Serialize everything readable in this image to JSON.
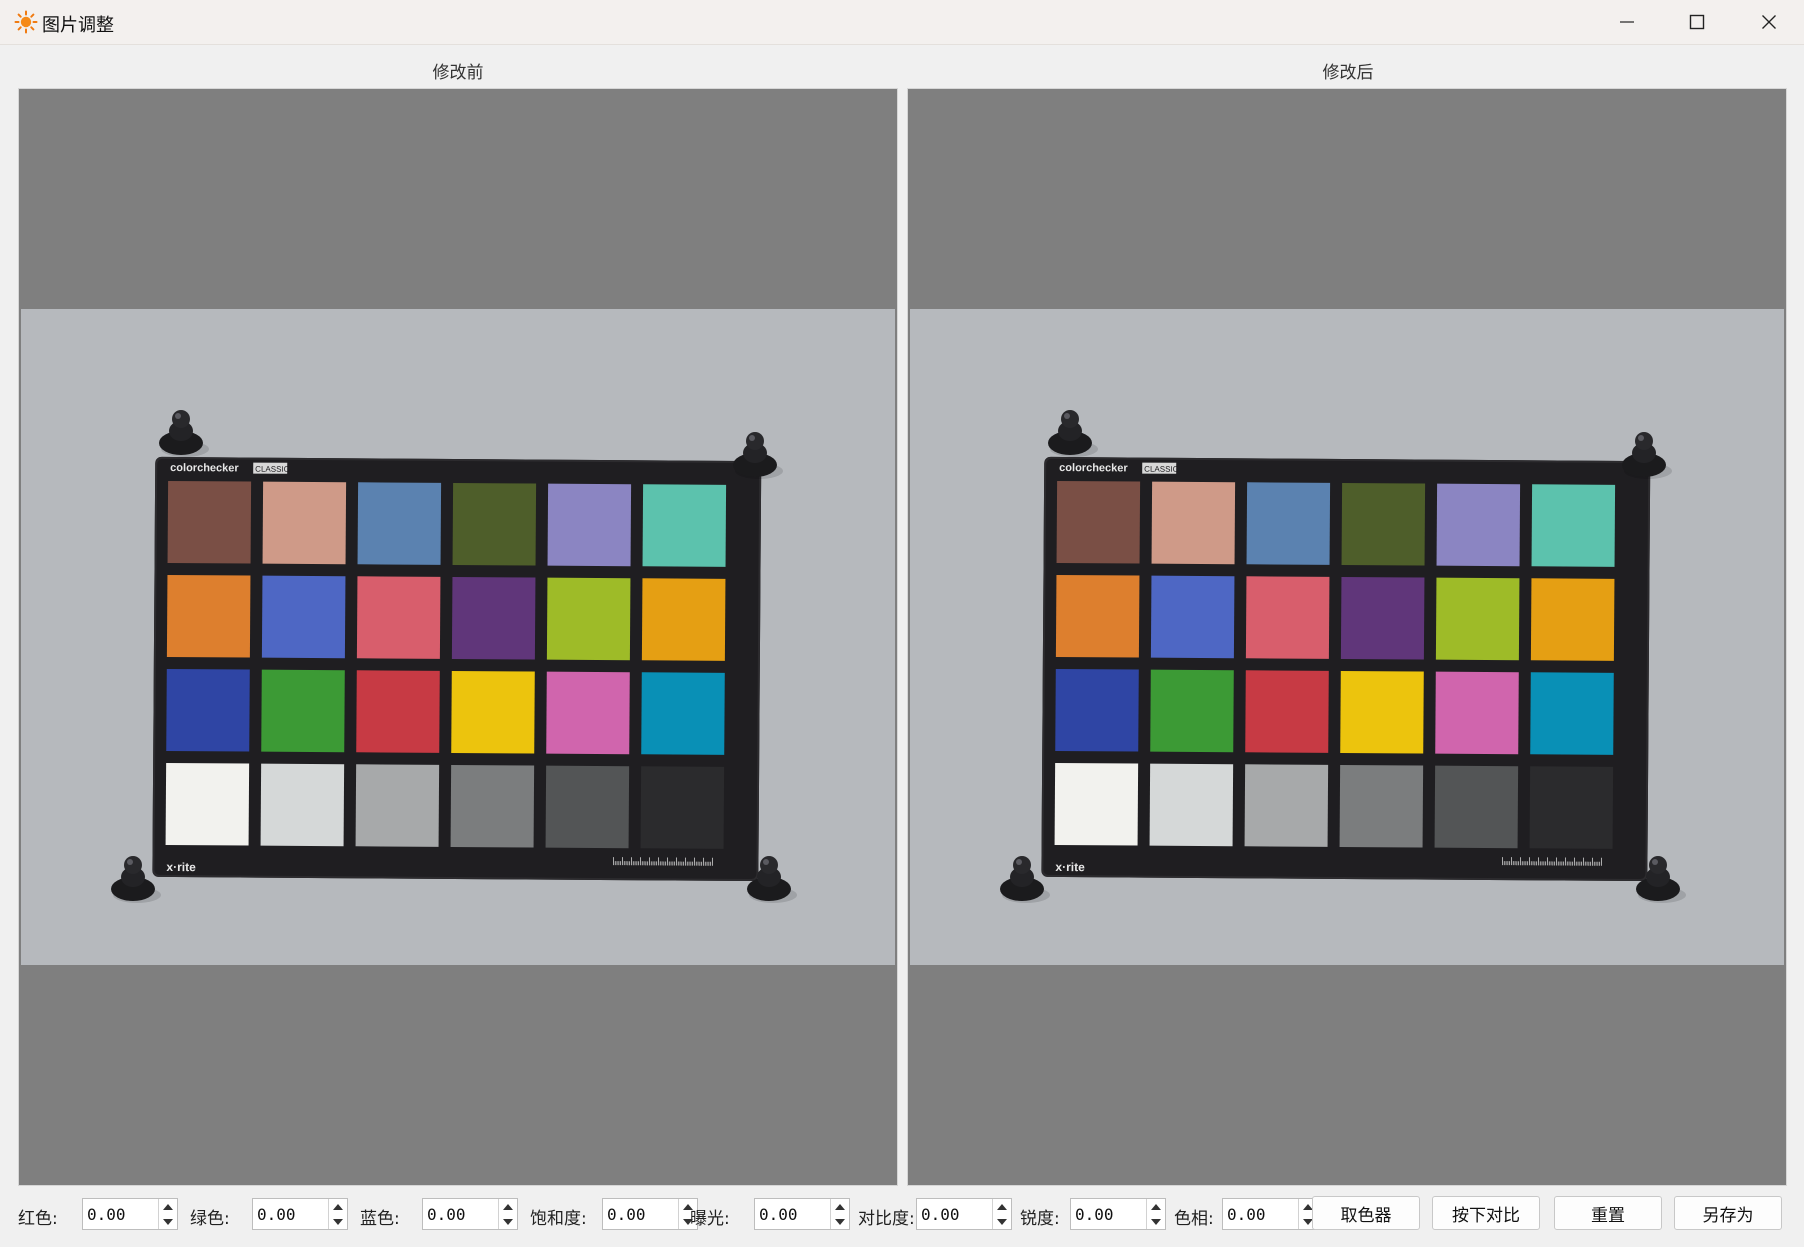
{
  "window": {
    "title": "图片调整",
    "minimize_icon": "minimize-icon",
    "maximize_icon": "maximize-icon",
    "close_icon": "close-icon",
    "app_icon": "sun-icon",
    "accent": "#f07a10"
  },
  "panels": {
    "before_label": "修改前",
    "after_label": "修改后"
  },
  "image": {
    "brand_text": "colorchecker",
    "brand_badge": "CLASSIC",
    "maker_text": "x·rite",
    "patches": [
      [
        "#7a4f45",
        "#cf9a88",
        "#5b82b0",
        "#4e5e2a",
        "#8b85c2",
        "#5cc2ad"
      ],
      [
        "#dd7f2e",
        "#4e67c4",
        "#d85e6c",
        "#60367a",
        "#9ebb28",
        "#e59f13"
      ],
      [
        "#2f45a4",
        "#3c9a35",
        "#c73a44",
        "#ecc40d",
        "#d065ad",
        "#0990b6"
      ],
      [
        "#f2f2ee",
        "#d5d8d8",
        "#a7a9aa",
        "#7b7d7e",
        "#535556",
        "#2b2b2d"
      ]
    ]
  },
  "controls": {
    "red": {
      "label": "红色:",
      "value": "0.00"
    },
    "green": {
      "label": "绿色:",
      "value": "0.00"
    },
    "blue": {
      "label": "蓝色:",
      "value": "0.00"
    },
    "saturation": {
      "label": "饱和度:",
      "value": "0.00"
    },
    "exposure": {
      "label": "曝光:",
      "value": "0.00"
    },
    "contrast": {
      "label": "对比度:",
      "value": "0.00"
    },
    "sharpness": {
      "label": "锐度:",
      "value": "0.00"
    },
    "hue": {
      "label": "色相:",
      "value": "0.00"
    },
    "buttons": {
      "picker": "取色器",
      "compare": "按下对比",
      "reset": "重置",
      "save_as": "另存为"
    }
  }
}
